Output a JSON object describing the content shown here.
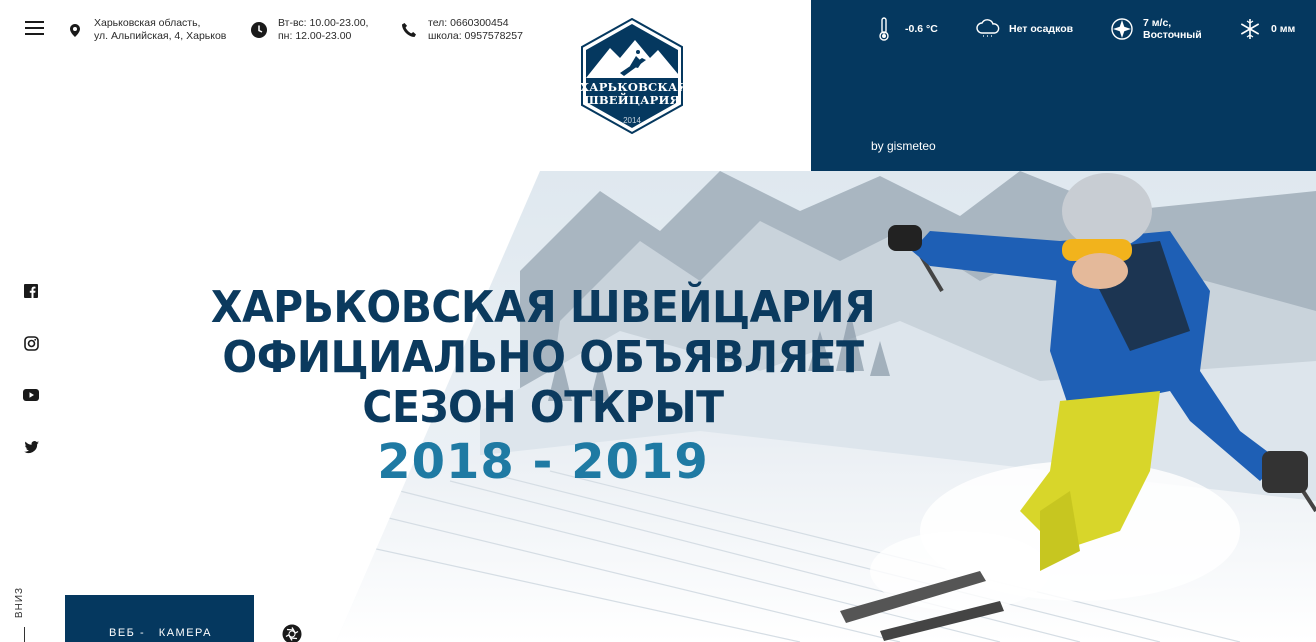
{
  "header": {
    "address": {
      "line1": "Харьковская область,",
      "line2": "ул. Альпийская, 4, Харьков",
      "icon": "map-pin-icon"
    },
    "hours": {
      "line1": "Вт-вс: 10.00-23.00,",
      "line2": "пн: 12.00-23.00",
      "icon": "clock-icon"
    },
    "phone": {
      "line1": "тел: 0660300454",
      "line2": "школа: 0957578257",
      "icon": "phone-icon"
    }
  },
  "logo": {
    "line1": "ХАРЬКОВСКАЯ",
    "line2": "ШВЕЙЦАРИЯ",
    "year": "2014"
  },
  "weather": {
    "temperature": "-0.6 °C",
    "precipitation": "Нет осадков",
    "wind_line1": "7 м/с,",
    "wind_line2": "Восточный",
    "snow": "0 мм",
    "provider": "by gismeteo"
  },
  "hero": {
    "line1": "ХАРЬКОВСКАЯ ШВЕЙЦАРИЯ",
    "line2": "ОФИЦИАЛЬНО ОБЪЯВЛЯЕТ",
    "line3": "СЕЗОН ОТКРЫТ",
    "years": "2018 - 2019"
  },
  "social": [
    "facebook-icon",
    "instagram-icon",
    "youtube-icon",
    "twitter-icon"
  ],
  "scroll_down": "ВНИЗ",
  "webcam": {
    "label": "ВЕБ -   КАМЕРА"
  },
  "colors": {
    "navy": "#05385f",
    "headline": "#0b3a5e",
    "accent_blue": "#1f7aa3"
  }
}
